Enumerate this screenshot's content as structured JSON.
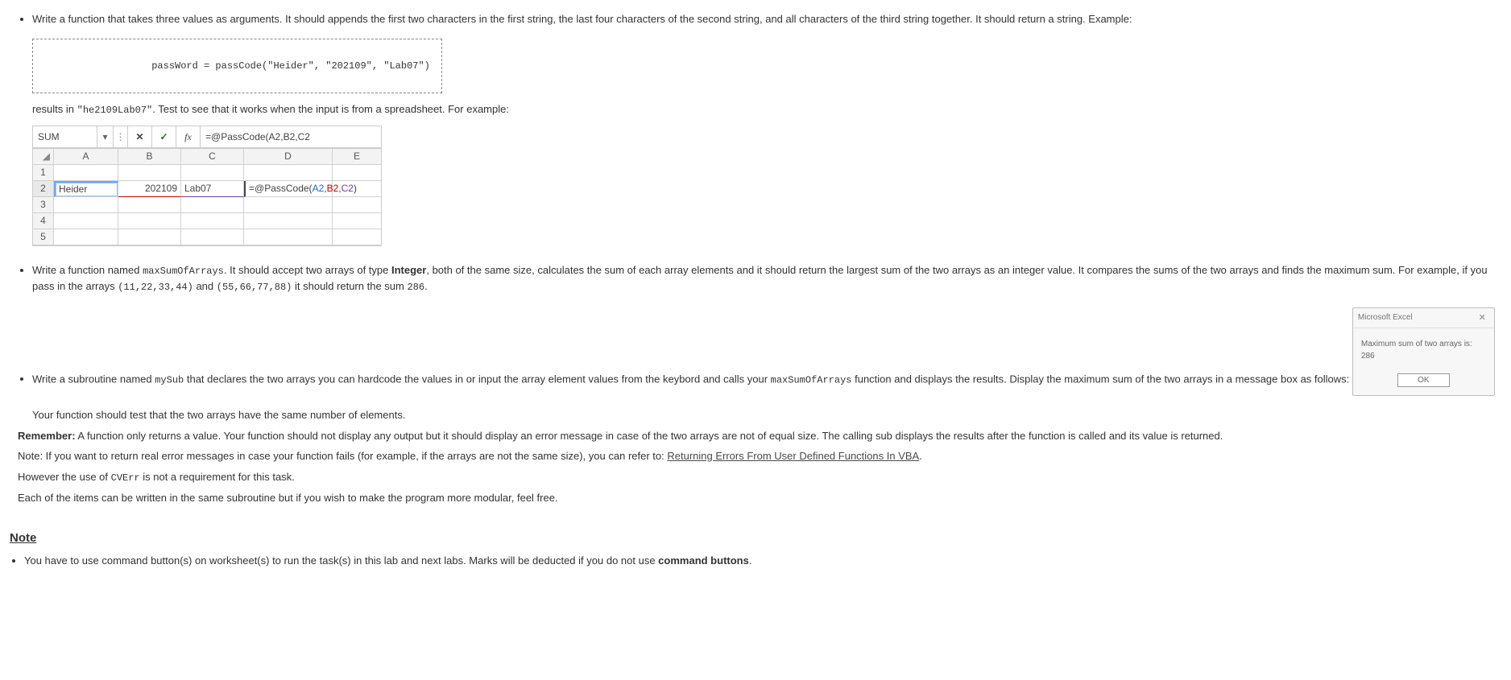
{
  "bullets": {
    "b1_text": "Write a function that takes three values as arguments. It should appends the first two characters in the first string, the last four characters of the second string, and all characters of the third string together. It should return a string. Example:",
    "code_block": "passWord = passCode(\"Heider\", \"202109\", \"Lab07\")",
    "b1_results_prefix": "results in ",
    "b1_results_code": "\"he2109Lab07\"",
    "b1_results_suffix": ". Test to see that it works when the input is from a spreadsheet. For example:",
    "b2_prefix": "Write a function named ",
    "b2_fn": "maxSumOfArrays",
    "b2_mid1": ". It should accept two arrays of type ",
    "b2_integer": "Integer",
    "b2_mid2": ", both of the same size, calculates the sum of each array elements and it should return the largest sum of the two arrays as an integer value. It compares the sums of the two arrays and finds the maximum sum. For example, if you pass in the arrays ",
    "b2_arr1": "(11,22,33,44)",
    "b2_and": " and ",
    "b2_arr2": "(55,66,77,88)",
    "b2_mid3": " it should return the sum ",
    "b2_sum": "286",
    "b2_end": ".",
    "b3_prefix": "Write a subroutine named ",
    "b3_fn": "mySub",
    "b3_mid1": " that declares the two arrays you can hardcode the values in or input the array element values from the keybord and calls your ",
    "b3_fn2": "maxSumOfArrays",
    "b3_suffix": " function and displays the results. Display the maximum sum of the two arrays in a message box as follows:"
  },
  "excel": {
    "namebox": "SUM",
    "fx_label": "fx",
    "formula_bar": "=@PassCode(A2,B2,C2",
    "cols": [
      "A",
      "B",
      "C",
      "D",
      "E"
    ],
    "rows": [
      "1",
      "2",
      "3",
      "4",
      "5"
    ],
    "r2": {
      "A": "Heider",
      "B": "202109",
      "C": "Lab07",
      "D_pre": "=@PassCode(",
      "D_a": "A2",
      "D_s1": ",",
      "D_b": "B2",
      "D_s2": ",",
      "D_c": "C2",
      "D_post": ")"
    }
  },
  "msgbox": {
    "title": "Microsoft Excel",
    "body_line1": "Maximum sum of two arrays is:",
    "body_line2": "286",
    "ok": "OK"
  },
  "after_msgbox": "Your function should test that the two arrays have the same number of elements.",
  "remember_label": "Remember:",
  "remember_text": " A function only returns a value. Your function should not display any output but it should display an error message in case of the two arrays are not of equal size. The calling sub displays the results after the function is called and its value is returned.",
  "note_err_prefix": "Note: If you want to return real error messages in case your function fails (for example, if the arrays are not the same size), you can refer to: ",
  "note_err_link": "Returning Errors From User Defined Functions In VBA",
  "note_err_suffix": ".",
  "however_prefix": "However the use of ",
  "however_code": "CVErr",
  "however_suffix": " is not a requirement for this task.",
  "each_items": "Each of the items can be written in the same subroutine but if you wish to make the program more modular, feel free.",
  "note_heading": "Note",
  "note_bullet_prefix": "You have to use command button(s) on worksheet(s) to run the task(s) in this lab and next labs. Marks will be deducted if you do not use ",
  "note_bullet_bold": "command buttons",
  "note_bullet_suffix": "."
}
